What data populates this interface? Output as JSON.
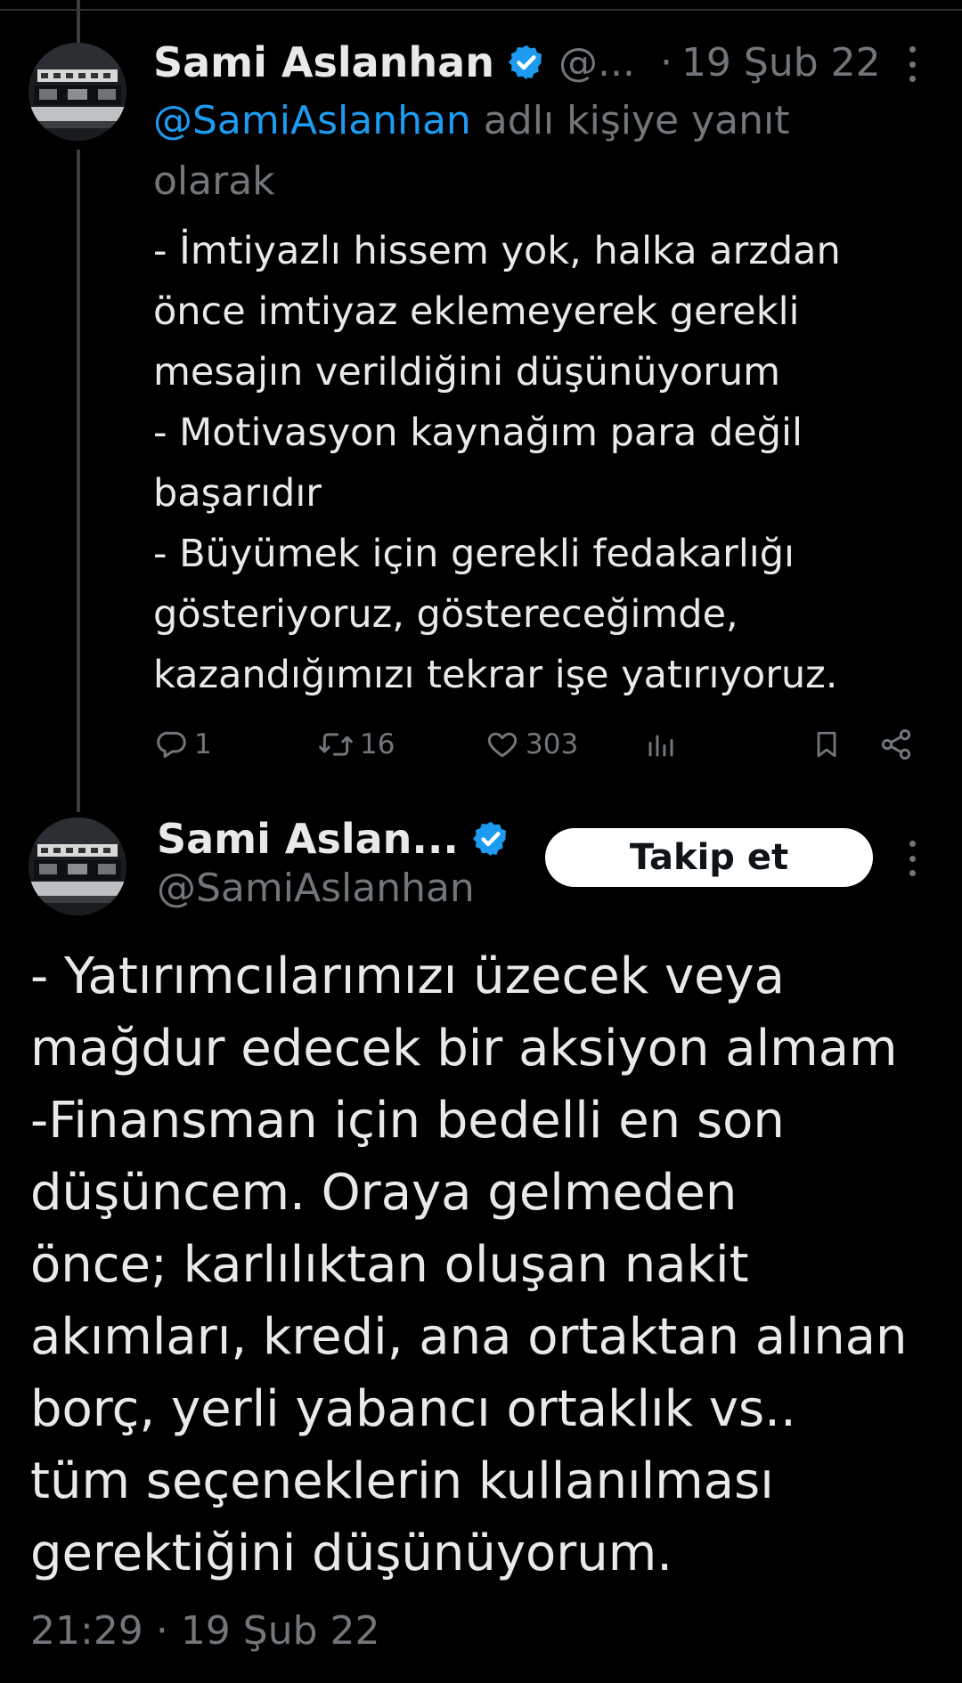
{
  "reply_tweet": {
    "author": {
      "name": "Sami Aslanhan",
      "handle_truncated": "@...",
      "verified": true
    },
    "separator": "·",
    "date": "19 Şub 22",
    "reply_context": {
      "mention": "@SamiAslanhan",
      "line1_rest": " adlı kişiye yanıt",
      "line2": "olarak"
    },
    "body_lines": [
      "- İmtiyazlı hissem yok, halka arzdan",
      "önce imtiyaz eklemeyerek gerekli",
      "mesajın verildiğini düşünüyorum",
      "- Motivasyon kaynağım para değil",
      "başarıdır",
      "- Büyümek için gerekli fedakarlığı",
      "gösteriyoruz, göstereceğimde,",
      "kazandığımızı tekrar işe yatırıyoruz."
    ],
    "actions": {
      "replies": "1",
      "retweets": "16",
      "likes": "303"
    }
  },
  "main_tweet": {
    "author": {
      "name": "Sami Aslan...",
      "handle": "@SamiAslanhan",
      "verified": true
    },
    "follow_label": "Takip et",
    "body_lines": [
      "- Yatırımcılarımızı üzecek veya",
      "mağdur edecek bir aksiyon almam",
      "-Finansman için bedelli en son",
      "düşüncem. Oraya gelmeden",
      "önce; karlılıktan oluşan nakit",
      "akımları, kredi, ana ortaktan alınan",
      "borç, yerli yabancı ortaklık vs..",
      "tüm seçeneklerin kullanılması",
      "gerektiğini düşünüyorum."
    ],
    "time": "21:29",
    "separator": "·",
    "date": "19 Şub 22"
  },
  "colors": {
    "background": "#000000",
    "text_primary": "#e7e9ea",
    "text_secondary": "#71767b",
    "accent_blue": "#1d9bf0",
    "thread_line": "#3a3d40",
    "button_bg": "#ffffff"
  },
  "icons": {
    "verified": "verified-badge-icon",
    "more": "more-vertical-icon",
    "reply": "reply-bubble-icon",
    "retweet": "retweet-icon",
    "like": "heart-icon",
    "views": "bar-chart-icon",
    "bookmark": "bookmark-icon",
    "share": "share-icon"
  }
}
